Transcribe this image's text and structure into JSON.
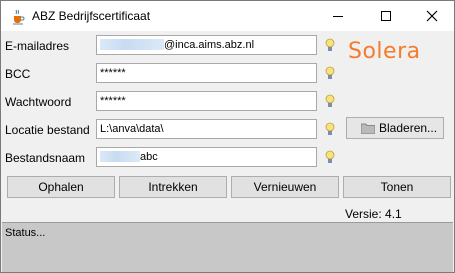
{
  "window": {
    "title": "ABZ Bedrijfscertificaat",
    "icon": "java-cup-icon"
  },
  "form": {
    "email": {
      "label": "E-mailadres",
      "value_prefix": "",
      "value_suffix": "@inca.aims.abz.nl"
    },
    "bcc": {
      "label": "BCC",
      "value": "******"
    },
    "password": {
      "label": "Wachtwoord",
      "value": "******"
    },
    "location": {
      "label": "Locatie bestand",
      "value": "L:\\anva\\data\\"
    },
    "filename": {
      "label": "Bestandsnaam",
      "value_prefix": "",
      "value_suffix": "abc"
    }
  },
  "logo": {
    "text": "Solera",
    "color": "#f47c2c"
  },
  "buttons": {
    "browse": "Bladeren...",
    "ophalen": "Ophalen",
    "intrekken": "Intrekken",
    "vernieuwen": "Vernieuwen",
    "tonen": "Tonen"
  },
  "version": "Versie: 4.1",
  "status": "Status..."
}
